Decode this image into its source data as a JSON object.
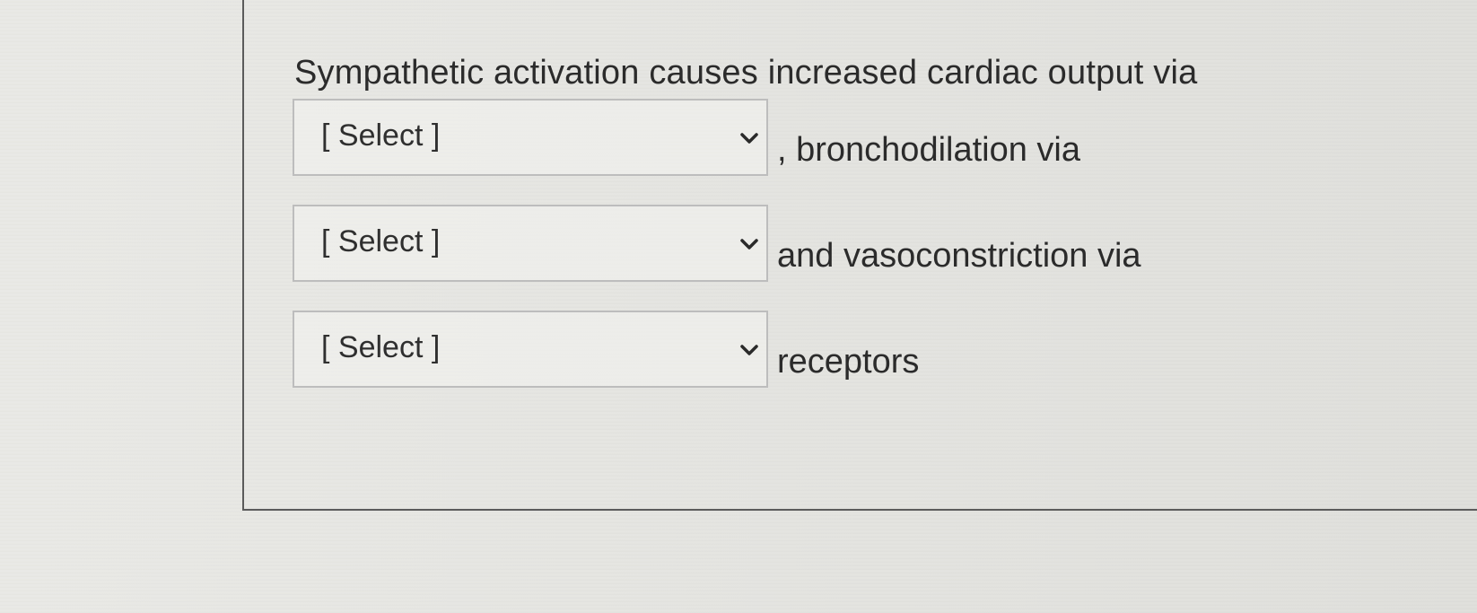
{
  "question": {
    "intro_text": "Sympathetic activation causes increased cardiac output via",
    "rows": [
      {
        "select_value": "[ Select ]",
        "after_text": ", bronchodilation via"
      },
      {
        "select_value": "[ Select ]",
        "after_text": "and vasoconstriction via"
      },
      {
        "select_value": "[ Select ]",
        "after_text": "receptors"
      }
    ]
  },
  "icons": {
    "dropdown": "chevron-down-icon"
  }
}
